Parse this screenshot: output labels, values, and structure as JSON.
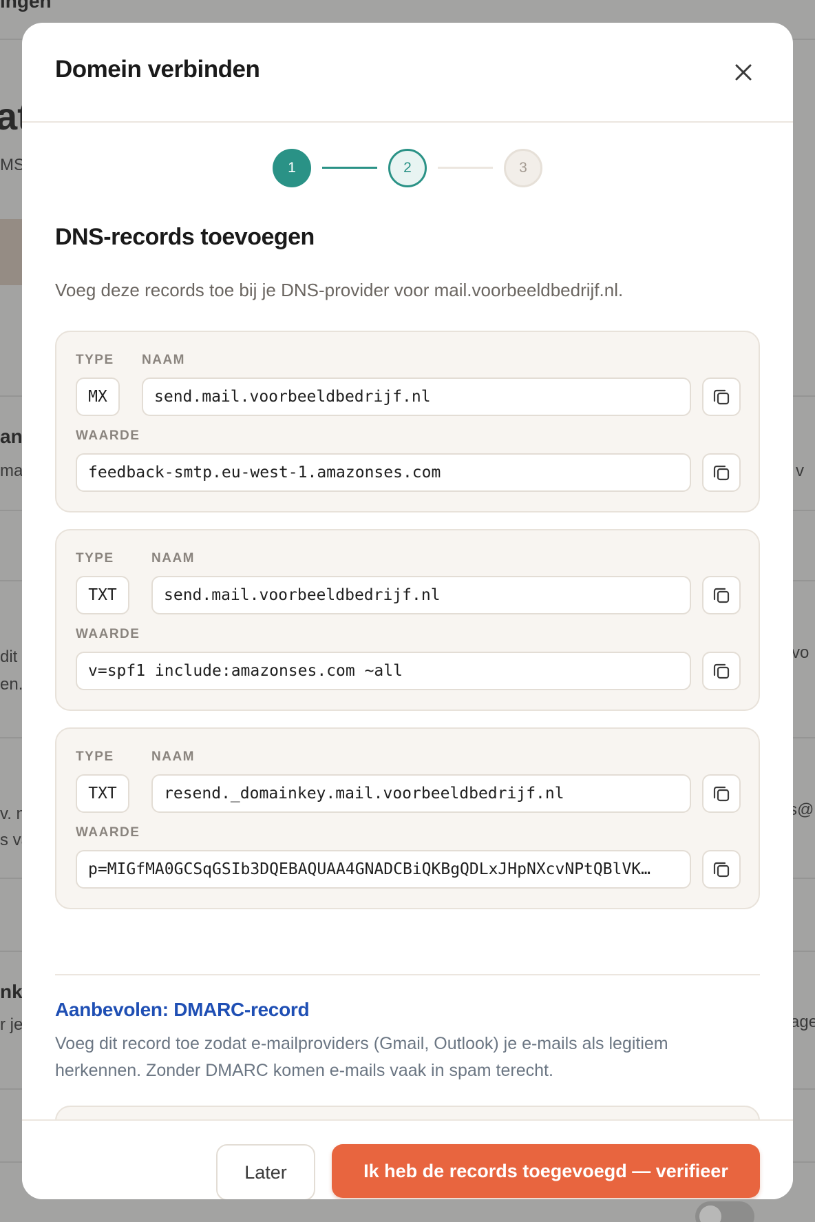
{
  "background": {
    "fragments": [
      "ingen",
      "at",
      "MS-",
      "ana",
      "ma",
      "e v",
      "dit",
      "en.",
      "vo",
      "v. n",
      "s va",
      "s@",
      "nk",
      "r je",
      "age"
    ]
  },
  "modal": {
    "title": "Domein verbinden",
    "close_icon": "close-icon",
    "stepper": {
      "steps": [
        "1",
        "2",
        "3"
      ]
    },
    "section_title": "DNS-records toevoegen",
    "section_desc": "Voeg deze records toe bij je DNS-provider voor mail.voorbeeldbedrijf.nl.",
    "labels": {
      "type": "TYPE",
      "name": "NAAM",
      "value": "WAARDE"
    },
    "records": [
      {
        "type": "MX",
        "name": "send.mail.voorbeeldbedrijf.nl",
        "value": "feedback-smtp.eu-west-1.amazonses.com"
      },
      {
        "type": "TXT",
        "name": "send.mail.voorbeeldbedrijf.nl",
        "value": "v=spf1 include:amazonses.com ~all"
      },
      {
        "type": "TXT",
        "name": "resend._domainkey.mail.voorbeeldbedrijf.nl",
        "value": "p=MIGfMA0GCSqGSIb3DQEBAQUAA4GNADCBiQKBgQDLxJHpNXcvNPtQBlVK…"
      }
    ],
    "dmarc": {
      "title": "Aanbevolen: DMARC-record",
      "desc": "Voeg dit record toe zodat e-mailproviders (Gmail, Outlook) je e-mails als legitiem herkennen. Zonder DMARC komen e-mails vaak in spam terecht."
    },
    "footer": {
      "later_label": "Later",
      "verify_label": "Ik heb de records toegevoegd — verifieer"
    }
  },
  "colors": {
    "accent": "#2a9286",
    "primary_button": "#e8653f",
    "dmarc_title": "#1f4fb4"
  }
}
